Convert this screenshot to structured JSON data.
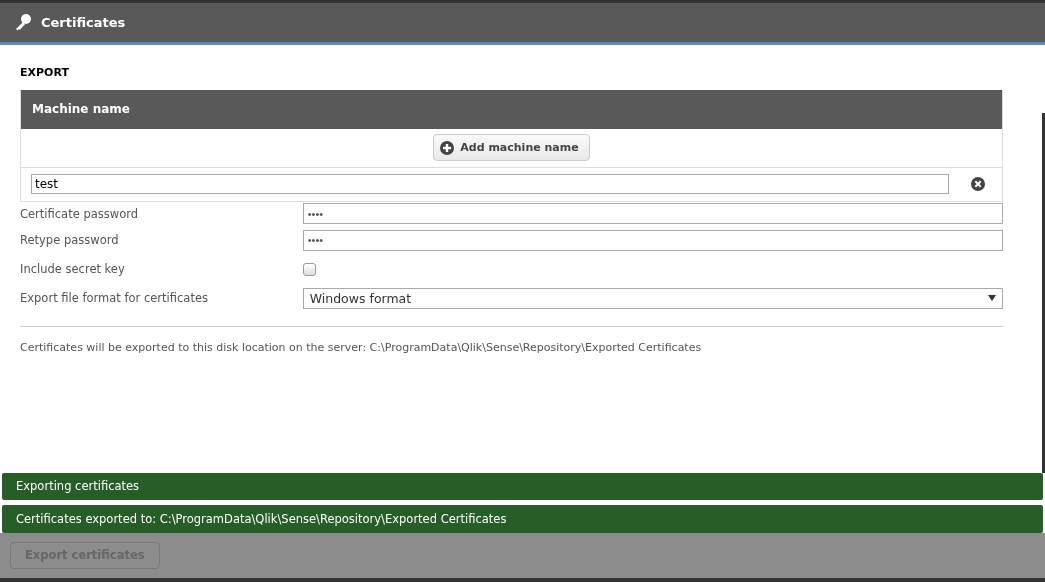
{
  "header": {
    "title": "Certificates"
  },
  "section": {
    "title": "EXPORT"
  },
  "machine_table": {
    "header": "Machine name",
    "add_button": "Add machine name",
    "rows": [
      {
        "value": "test"
      }
    ]
  },
  "form": [
    {
      "kind": "password",
      "label": "Certificate password",
      "value": "••••"
    },
    {
      "kind": "password",
      "label": "Retype password",
      "value": "••••"
    },
    {
      "kind": "checkbox",
      "label": "Include secret key",
      "checked": false
    },
    {
      "kind": "select",
      "label": "Export file format for certificates",
      "value": "Windows format"
    }
  ],
  "info": "Certificates will be exported to this disk location on the server: C:\\ProgramData\\Qlik\\Sense\\Repository\\Exported Certificates",
  "notifications": [
    "Exporting certificates",
    "Certificates exported to: C:\\ProgramData\\Qlik\\Sense\\Repository\\Exported Certificates"
  ],
  "footer": {
    "button": "Export certificates",
    "disabled": true
  }
}
